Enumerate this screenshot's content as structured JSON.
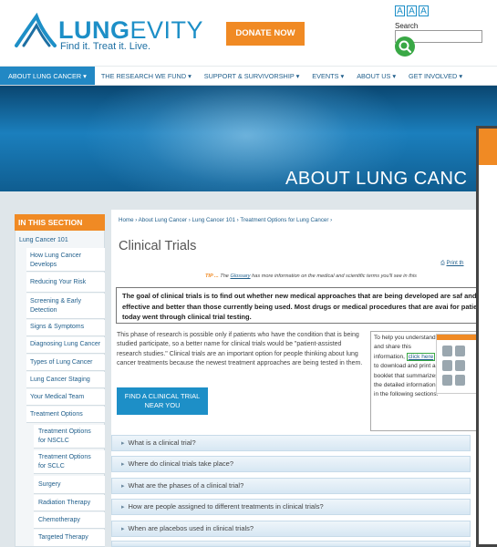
{
  "header": {
    "logo_word_bold": "LUNG",
    "logo_word_light": "EVITY",
    "logo_tagline": "Find it. Treat it. Live.",
    "donate_label": "DONATE NOW",
    "text_size_labels": [
      "A",
      "A",
      "A"
    ],
    "search_label": "Search",
    "search_placeholder": ""
  },
  "nav": {
    "items": [
      {
        "label": "ABOUT LUNG CANCER ▾"
      },
      {
        "label": "THE RESEARCH WE FUND ▾"
      },
      {
        "label": "SUPPORT & SURVIVORSHIP ▾"
      },
      {
        "label": "EVENTS ▾"
      },
      {
        "label": "ABOUT US ▾"
      },
      {
        "label": "GET INVOLVED ▾"
      }
    ]
  },
  "banner": {
    "title": "ABOUT LUNG CANC"
  },
  "sidebar": {
    "heading": "IN THIS SECTION",
    "top_item": "Lung Cancer 101",
    "items": [
      "How Lung Cancer Develops",
      "Reducing Your Risk",
      "Screening & Early Detection",
      "Signs & Symptoms",
      "Diagnosing Lung Cancer",
      "Types of Lung Cancer",
      "Lung Cancer Staging",
      "Your Medical Team",
      "Treatment Options"
    ],
    "sub_items": [
      "Treatment Options for NSCLC",
      "Treatment Options for SCLC",
      "Surgery",
      "Radiation Therapy",
      "Chemotherapy",
      "Targeted Therapy"
    ]
  },
  "main": {
    "breadcrumb": "Home › About Lung Cancer › Lung Cancer 101 › Treatment Options for Lung Cancer ›",
    "title": "Clinical Trials",
    "print_label": "Print th",
    "tip_word": "TIP ...",
    "tip_pre": "The",
    "tip_link": "Glossary",
    "tip_post": "has more information on the medical and scientific terms you'll see in this",
    "goal_text": "The goal of clinical trials is to find out whether new medical approaches that are being developed are saf and effective and better than those currently being used. Most drugs or medical procedures that are avai for patients today went through clinical trial testing.",
    "body_text": "This phase of research is possible only if patients who have the condition that is being studied participate, so a better name for clinical trials would be \"patient-assisted research studies.\" Clinical trials are an important option for people thinking about lung cancer treatments because the newest treatment approaches are being tested in them.",
    "find_trial_button": "FIND A CLINICAL TRIAL NEAR YOU",
    "aside_pre": "To help you understand and share this information,",
    "aside_link": "click here",
    "aside_post": "to download and print a booklet that summarizes the detailed information in the following sections.",
    "faq": [
      "What is a clinical trial?",
      "Where do clinical trials take place?",
      "What are the phases of a clinical trial?",
      "How are people assigned to different treatments in clinical trials?",
      "When are placebos used in clinical trials?"
    ]
  },
  "colors": {
    "brand_blue": "#1d8fc7",
    "accent_orange": "#f08a24",
    "search_green": "#39a845"
  }
}
